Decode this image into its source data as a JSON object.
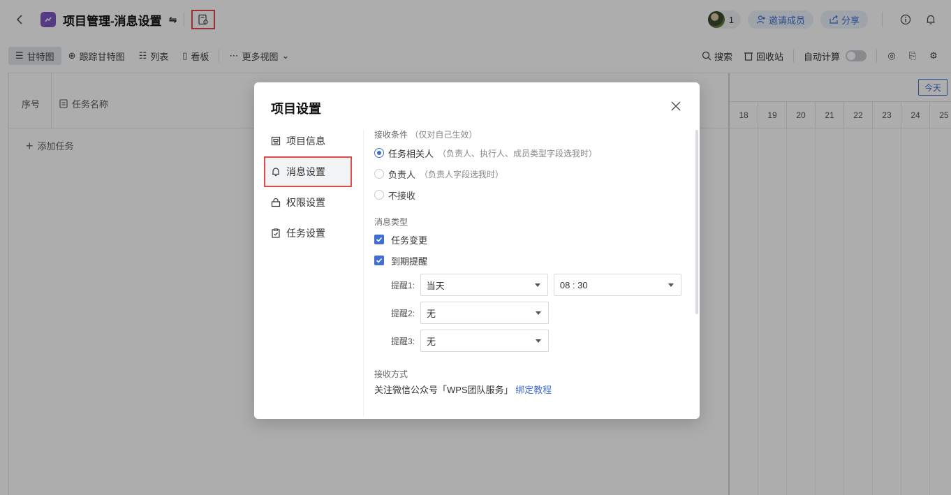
{
  "header": {
    "title": "项目管理-消息设置",
    "member_count": "1",
    "invite_label": "邀请成员",
    "share_label": "分享"
  },
  "toolbar": {
    "views": [
      {
        "label": "甘特图",
        "icon": "gantt-icon"
      },
      {
        "label": "跟踪甘特图",
        "icon": "target-icon"
      },
      {
        "label": "列表",
        "icon": "list-icon"
      },
      {
        "label": "看板",
        "icon": "kanban-icon"
      },
      {
        "label": "更多视图",
        "icon": "more-icon"
      }
    ],
    "search_label": "搜索",
    "recycle_label": "回收站",
    "auto_calc_label": "自动计算",
    "auto_calc_on": false
  },
  "table": {
    "col_seq": "序号",
    "col_name": "任务名称",
    "add_task": "添加任务"
  },
  "gantt": {
    "today_label": "今天",
    "days": [
      "18",
      "19",
      "20",
      "21",
      "22",
      "23",
      "24",
      "25"
    ]
  },
  "dialog": {
    "title": "项目设置",
    "nav": [
      {
        "label": "项目信息",
        "icon": "info-card-icon"
      },
      {
        "label": "消息设置",
        "icon": "bell-icon"
      },
      {
        "label": "权限设置",
        "icon": "lock-icon"
      },
      {
        "label": "任务设置",
        "icon": "clipboard-check-icon"
      }
    ],
    "receive_condition": {
      "label": "接收条件",
      "hint": "（仅对自己生效）",
      "options": [
        {
          "label": "任务相关人",
          "hint": "（负责人、执行人、成员类型字段选我时）",
          "selected": true
        },
        {
          "label": "负责人",
          "hint": "（负责人字段选我时）",
          "selected": false
        },
        {
          "label": "不接收",
          "hint": "",
          "selected": false
        }
      ]
    },
    "message_type": {
      "label": "消息类型",
      "task_change": "任务变更",
      "due_reminder": "到期提醒"
    },
    "reminders": [
      {
        "label": "提醒1:",
        "day": "当天",
        "time": "08 : 30"
      },
      {
        "label": "提醒2:",
        "day": "无"
      },
      {
        "label": "提醒3:",
        "day": "无"
      }
    ],
    "receive_method": {
      "label": "接收方式",
      "text": "关注微信公众号「WPS团队服务」",
      "link": "绑定教程"
    }
  }
}
